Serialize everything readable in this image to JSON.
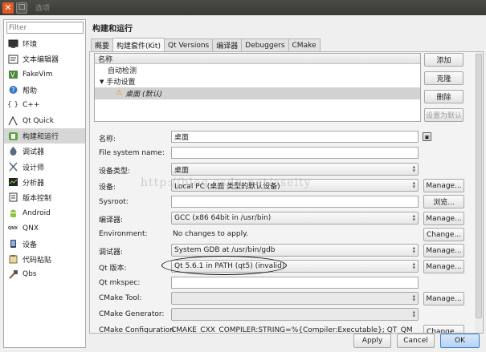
{
  "window": {
    "title": "选项"
  },
  "sidebar": {
    "filter_placeholder": "Filter",
    "items": [
      {
        "label": "环境",
        "icon": "monitor-icon"
      },
      {
        "label": "文本编辑器",
        "icon": "text-editor-icon"
      },
      {
        "label": "FakeVim",
        "icon": "fakevim-icon"
      },
      {
        "label": "帮助",
        "icon": "help-icon"
      },
      {
        "label": "C++",
        "icon": "cpp-braces-icon"
      },
      {
        "label": "Qt Quick",
        "icon": "qt-quick-icon"
      },
      {
        "label": "构建和运行",
        "icon": "build-run-icon",
        "selected": true
      },
      {
        "label": "调试器",
        "icon": "debugger-icon"
      },
      {
        "label": "设计师",
        "icon": "designer-icon"
      },
      {
        "label": "分析器",
        "icon": "analyzer-icon"
      },
      {
        "label": "版本控制",
        "icon": "version-control-icon"
      },
      {
        "label": "Android",
        "icon": "android-icon"
      },
      {
        "label": "QNX",
        "icon": "qnx-icon"
      },
      {
        "label": "设备",
        "icon": "device-icon"
      },
      {
        "label": "代码粘贴",
        "icon": "code-paste-icon"
      },
      {
        "label": "Qbs",
        "icon": "qbs-icon"
      }
    ]
  },
  "main": {
    "title": "构建和运行",
    "tabs": [
      {
        "label": "概要"
      },
      {
        "label": "构建套件(Kit)",
        "active": true
      },
      {
        "label": "Qt Versions"
      },
      {
        "label": "编译器"
      },
      {
        "label": "Debuggers"
      },
      {
        "label": "CMake"
      }
    ]
  },
  "kit_list": {
    "header": "名称",
    "auto_detected": "自动检测",
    "manual": "手动设置",
    "kit_name": "桌面 (默认)",
    "buttons": {
      "add": "添加",
      "clone": "克隆",
      "remove": "删除",
      "make_default": "设置为默认"
    }
  },
  "form": {
    "name_label": "名称:",
    "name_value": "桌面",
    "file_system_name_label": "File system name:",
    "file_system_name_value": "",
    "device_type_label": "设备类型:",
    "device_type_value": "桌面",
    "device_label": "设备:",
    "device_value": "Local PC (桌面 类型的默认设备)",
    "sysroot_label": "Sysroot:",
    "sysroot_value": "",
    "browse_label": "浏览...",
    "compiler_label": "编译器:",
    "compiler_value": "GCC (x86 64bit in /usr/bin)",
    "environment_label": "Environment:",
    "environment_value": "No changes to apply.",
    "change_label": "Change...",
    "debugger_label": "调试器:",
    "debugger_value": "System GDB at /usr/bin/gdb",
    "qt_version_label": "Qt 版本:",
    "qt_version_value": "Qt 5.6.1 in PATH (qt5) (invalid)",
    "qt_mkspec_label": "Qt mkspec:",
    "qt_mkspec_value": "",
    "cmake_tool_label": "CMake Tool:",
    "cmake_tool_value": "",
    "cmake_generator_label": "CMake Generator:",
    "cmake_generator_value": "",
    "cmake_config_label": "CMake Configuration",
    "cmake_config_value": "CMAKE_CXX_COMPILER:STRING=%{Compiler:Executable}; QT_QMAKE_EXE",
    "manage_label": "Manage..."
  },
  "watermark": "http://blog.csdn.net/aseity",
  "dialog": {
    "apply": "Apply",
    "cancel": "Cancel",
    "ok": "OK"
  }
}
